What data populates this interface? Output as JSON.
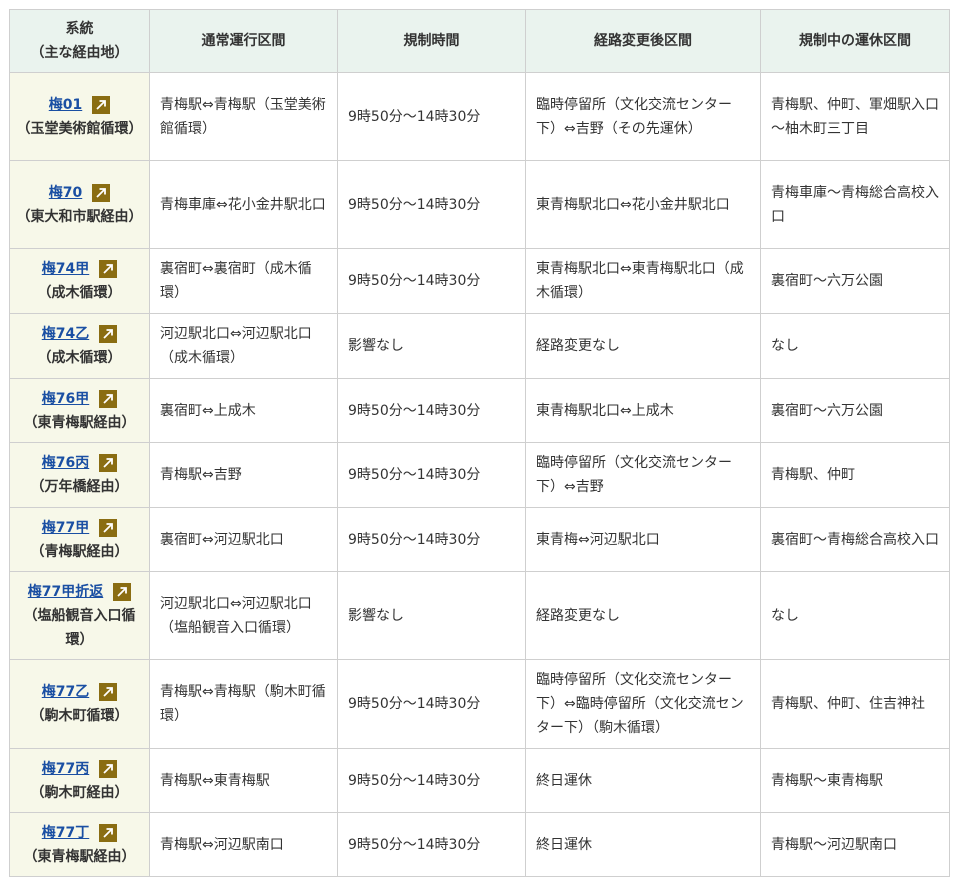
{
  "table": {
    "headers": {
      "route": "系統",
      "route_sub": "（主な経由地）",
      "normal": "通常運行区間",
      "time": "規制時間",
      "changed": "経路変更後区間",
      "suspended": "規制中の運休区間"
    },
    "rows": [
      {
        "route": "梅01",
        "via": "（玉堂美術館循環）",
        "normal": "青梅駅⇔青梅駅（玉堂美術館循環）",
        "time": "9時50分～14時30分",
        "changed": "臨時停留所（文化交流センター下）⇔吉野（その先運休）",
        "suspended": "青梅駅、仲町、軍畑駅入口～柚木町三丁目"
      },
      {
        "route": "梅70",
        "via": "（東大和市駅経由）",
        "normal": "青梅車庫⇔花小金井駅北口",
        "time": "9時50分～14時30分",
        "changed": "東青梅駅北口⇔花小金井駅北口",
        "suspended": "青梅車庫～青梅総合高校入口"
      },
      {
        "route": "梅74甲",
        "via": "（成木循環）",
        "normal": "裏宿町⇔裏宿町（成木循環）",
        "time": "9時50分～14時30分",
        "changed": "東青梅駅北口⇔東青梅駅北口（成木循環）",
        "suspended": "裏宿町～六万公園"
      },
      {
        "route": "梅74乙",
        "via": "（成木循環）",
        "normal": "河辺駅北口⇔河辺駅北口（成木循環）",
        "time": "影響なし",
        "changed": "経路変更なし",
        "suspended": "なし"
      },
      {
        "route": "梅76甲",
        "via": "（東青梅駅経由）",
        "normal": "裏宿町⇔上成木",
        "time": "9時50分～14時30分",
        "changed": "東青梅駅北口⇔上成木",
        "suspended": "裏宿町～六万公園"
      },
      {
        "route": "梅76丙",
        "via": "（万年橋経由）",
        "normal": "青梅駅⇔吉野",
        "time": "9時50分～14時30分",
        "changed": "臨時停留所（文化交流センター下）⇔吉野",
        "suspended": "青梅駅、仲町"
      },
      {
        "route": "梅77甲",
        "via": "（青梅駅経由）",
        "normal": "裏宿町⇔河辺駅北口",
        "time": "9時50分～14時30分",
        "changed": "東青梅⇔河辺駅北口",
        "suspended": "裏宿町～青梅総合高校入口"
      },
      {
        "route": "梅77甲折返",
        "via": "（塩船観音入口循環）",
        "normal": "河辺駅北口⇔河辺駅北口（塩船観音入口循環）",
        "time": "影響なし",
        "changed": "経路変更なし",
        "suspended": "なし"
      },
      {
        "route": "梅77乙",
        "via": "（駒木町循環）",
        "normal": "青梅駅⇔青梅駅（駒木町循環）",
        "time": "9時50分～14時30分",
        "changed": "臨時停留所（文化交流センター下）⇔臨時停留所（文化交流センター下）（駒木循環）",
        "suspended": "青梅駅、仲町、住吉神社"
      },
      {
        "route": "梅77丙",
        "via": "（駒木町経由）",
        "normal": "青梅駅⇔東青梅駅",
        "time": "9時50分～14時30分",
        "changed": "終日運休",
        "suspended": "青梅駅～東青梅駅"
      },
      {
        "route": "梅77丁",
        "via": "（東青梅駅経由）",
        "normal": "青梅駅⇔河辺駅南口",
        "time": "9時50分～14時30分",
        "changed": "終日運休",
        "suspended": "青梅駅～河辺駅南口"
      }
    ]
  }
}
